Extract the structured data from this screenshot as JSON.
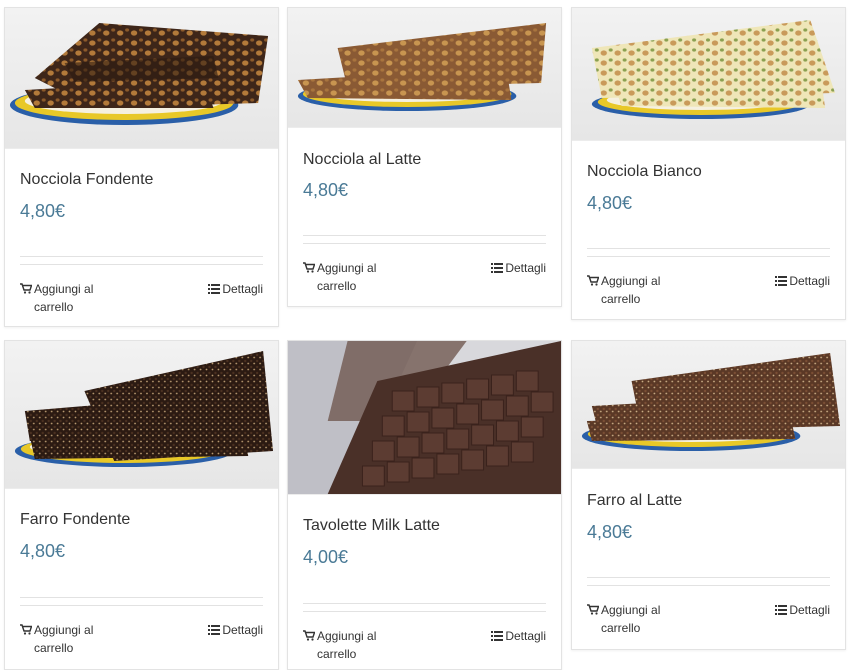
{
  "products": [
    {
      "name": "Nocciola Fondente",
      "price": "4,80€",
      "add_line1": "Aggiungi al",
      "add_line2": "carrello",
      "details": "Dettagli"
    },
    {
      "name": "Nocciola al Latte",
      "price": "4,80€",
      "add_line1": "Aggiungi al",
      "add_line2": "carrello",
      "details": "Dettagli"
    },
    {
      "name": "Nocciola Bianco",
      "price": "4,80€",
      "add_line1": "Aggiungi al",
      "add_line2": "carrello",
      "details": "Dettagli"
    },
    {
      "name": "Farro Fondente",
      "price": "4,80€",
      "add_line1": "Aggiungi al",
      "add_line2": "carrello",
      "details": "Dettagli"
    },
    {
      "name": "Tavolette Milk Latte",
      "price": "4,00€",
      "add_line1": "Aggiungi al",
      "add_line2": "carrello",
      "details": "Dettagli"
    },
    {
      "name": "Farro al Latte",
      "price": "4,80€",
      "add_line1": "Aggiungi al",
      "add_line2": "carrello",
      "details": "Dettagli"
    }
  ],
  "icons": {
    "cart": "shopping-cart-icon",
    "details": "list-icon"
  },
  "colors": {
    "price": "#4a7a96",
    "text": "#333333",
    "border": "#e3e3e3"
  }
}
